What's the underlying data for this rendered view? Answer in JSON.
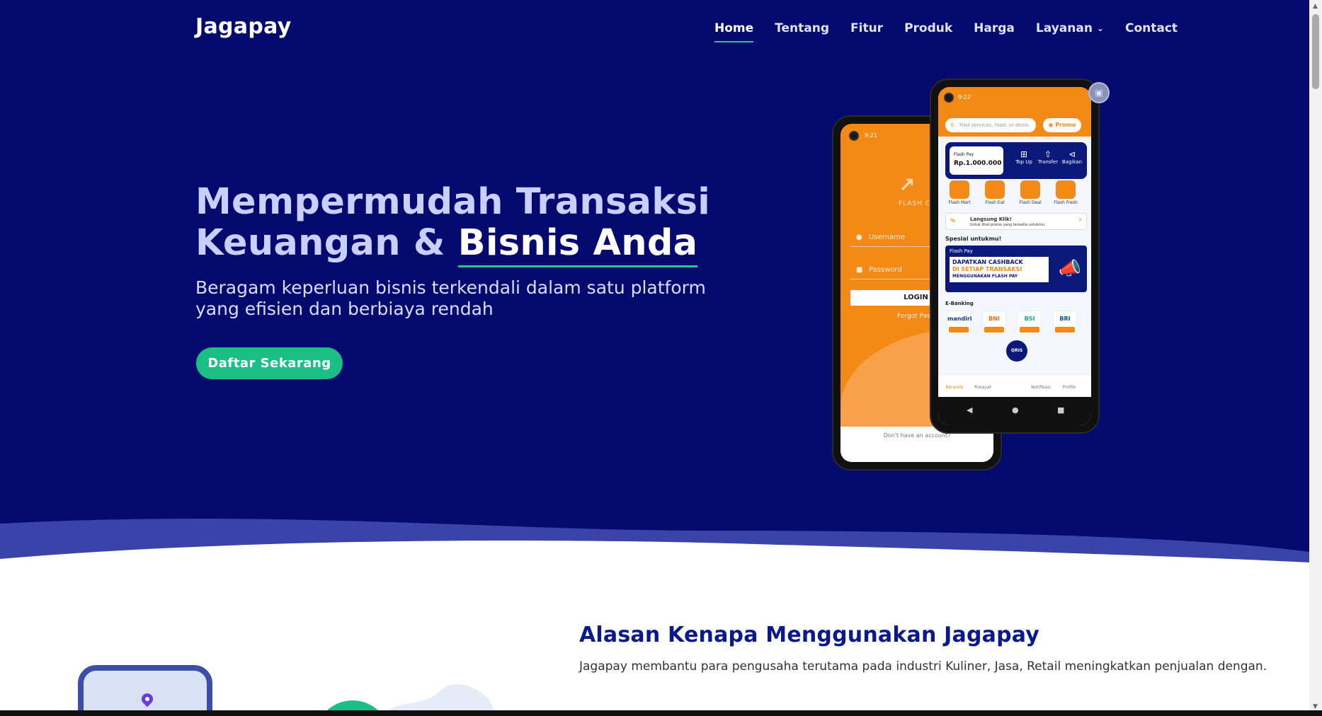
{
  "brand": "Jagapay",
  "nav": {
    "items": [
      {
        "label": "Home",
        "active": true
      },
      {
        "label": "Tentang"
      },
      {
        "label": "Fitur"
      },
      {
        "label": "Produk"
      },
      {
        "label": "Harga"
      },
      {
        "label": "Layanan",
        "dropdown": true
      },
      {
        "label": "Contact"
      }
    ]
  },
  "hero": {
    "title_part1": "Mempermudah Transaksi Keuangan & ",
    "title_highlight": "Bisnis Anda",
    "subtitle": "Beragam keperluan bisnis terkendali dalam satu platform yang efisien dan berbiaya rendah",
    "cta_label": "Daftar Sekarang"
  },
  "login_phone": {
    "time": "9:21",
    "brand": "FLASH CA",
    "username_placeholder": "Username",
    "password_placeholder": "Password",
    "login_label": "LOGIN",
    "forgot_label": "Forgot Passw",
    "signup_prompt": "Don't have an account?"
  },
  "app_phone": {
    "time": "9:22",
    "search_placeholder": "Find services, food, or deals",
    "promo_label": "Promo",
    "card_title": "Flash Pay",
    "balance": "Rp.1.000.000",
    "actions": [
      "Top Up",
      "Transfer",
      "Bagikan"
    ],
    "services": [
      "Flash Mart",
      "Flash Eat",
      "Flash Deal",
      "Flash Fresh"
    ],
    "banner_title": "Langsung Klik!",
    "banner_sub": "Untuk lihat promo yang tersedia untukmu",
    "special_heading": "Spesial untukmu!",
    "promo_card_label": "Flash Pay",
    "promo_line1": "DAPATKAN CASHBACK",
    "promo_line2": "DI SETIAP TRANSAKSI",
    "promo_line3": "MENGGUNAKAN FLASH PAY",
    "ebanking_heading": "E-Banking",
    "banks": [
      "mandiri",
      "BNI",
      "BSI",
      "BRI"
    ],
    "tabs": [
      "Beranda",
      "Riwayat",
      "Notifikasi",
      "Profile"
    ]
  },
  "section": {
    "title": "Alasan Kenapa Menggunakan Jagapay",
    "text": "Jagapay membantu para pengusaha terutama pada industri Kuliner, Jasa, Retail meningkatkan penjualan dengan."
  },
  "colors": {
    "hero_bg": "#050a6f",
    "accent_green": "#1bbf86",
    "phone_orange": "#f38a16",
    "section_title": "#0b1a8a"
  },
  "icons": {
    "dropdown": "chevron-down-icon",
    "user": "user-icon",
    "lock": "lock-icon",
    "search": "search-icon",
    "promo": "promo-icon",
    "location": "location-pin-icon",
    "screen_capture": "screen-capture-icon"
  }
}
